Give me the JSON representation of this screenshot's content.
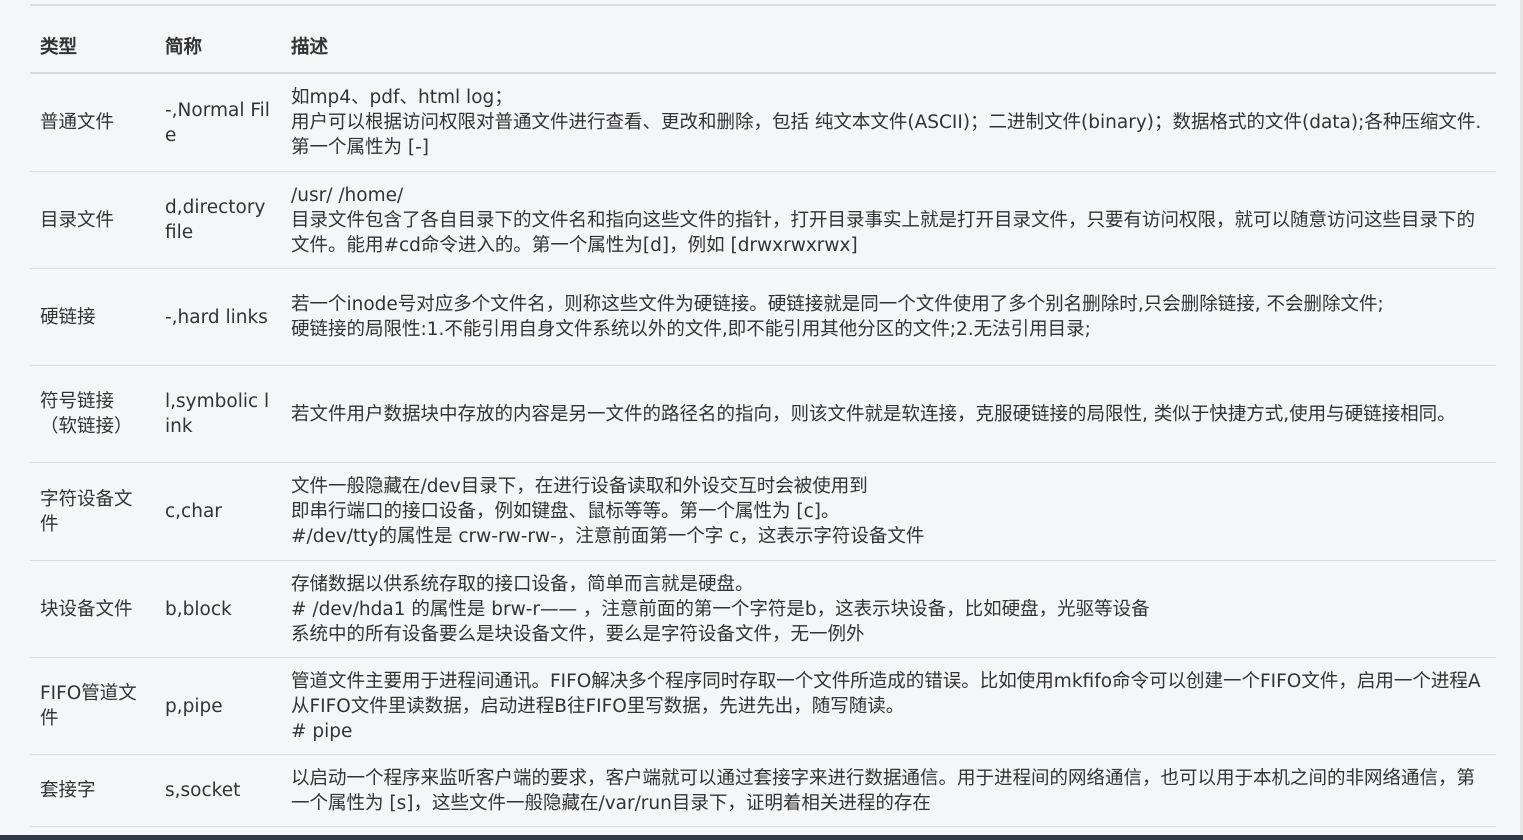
{
  "table": {
    "headers": {
      "type": "类型",
      "abbr": "简称",
      "desc": "描述"
    },
    "rows": [
      {
        "type": "普通文件",
        "abbr": "-,Normal File",
        "desc": [
          "如mp4、pdf、html log；",
          "用户可以根据访问权限对普通文件进行查看、更改和删除，包括 纯文本文件(ASCII)；二进制文件(binary)；数据格式的文件(data);各种压缩文件.第一个属性为 [-]"
        ]
      },
      {
        "type": "目录文件",
        "abbr": "d,directory file",
        "desc": [
          "/usr/ /home/",
          "目录文件包含了各自目录下的文件名和指向这些文件的指针，打开目录事实上就是打开目录文件，只要有访问权限，就可以随意访问这些目录下的文件。能用#cd命令进入的。第一个属性为[d]，例如 [drwxrwxrwx]"
        ]
      },
      {
        "type": "硬链接",
        "abbr": "-,hard links",
        "desc": [
          "若一个inode号对应多个文件名，则称这些文件为硬链接。硬链接就是同一个文件使用了多个别名删除时,只会删除链接, 不会删除文件;",
          "硬链接的局限性:1.不能引用自身文件系统以外的文件,即不能引用其他分区的文件;2.无法引用目录;"
        ]
      },
      {
        "type": "符号链接（软链接）",
        "abbr": "l,symbolic link",
        "desc": [
          "若文件用户数据块中存放的内容是另一文件的路径名的指向，则该文件就是软连接，克服硬链接的局限性, 类似于快捷方式,使用与硬链接相同。"
        ]
      },
      {
        "type": "字符设备文件",
        "abbr": "c,char",
        "desc": [
          "文件一般隐藏在/dev目录下，在进行设备读取和外设交互时会被使用到",
          "即串行端口的接口设备，例如键盘、鼠标等等。第一个属性为 [c]。",
          "#/dev/tty的属性是 crw-rw-rw-，注意前面第一个字 c，这表示字符设备文件"
        ]
      },
      {
        "type": "块设备文件",
        "abbr": "b,block",
        "desc": [
          "存储数据以供系统存取的接口设备，简单而言就是硬盘。",
          "# /dev/hda1 的属性是 brw-r—— ，注意前面的第一个字符是b，这表示块设备，比如硬盘，光驱等设备",
          "系统中的所有设备要么是块设备文件，要么是字符设备文件，无一例外"
        ]
      },
      {
        "type": "FIFO管道文件",
        "abbr": "p,pipe",
        "desc": [
          "管道文件主要用于进程间通讯。FIFO解决多个程序同时存取一个文件所造成的错误。比如使用mkfifo命令可以创建一个FIFO文件，启用一个进程A从FIFO文件里读数据，启动进程B往FIFO里写数据，先进先出，随写随读。",
          "# pipe"
        ]
      },
      {
        "type": "套接字",
        "abbr": "s,socket",
        "desc": [
          "以启动一个程序来监听客户端的要求，客户端就可以通过套接字来进行数据通信。用于进程间的网络通信，也可以用于本机之间的非网络通信，第一个属性为 [s]，这些文件一般隐藏在/var/run目录下，证明着相关进程的存在"
        ]
      }
    ]
  }
}
